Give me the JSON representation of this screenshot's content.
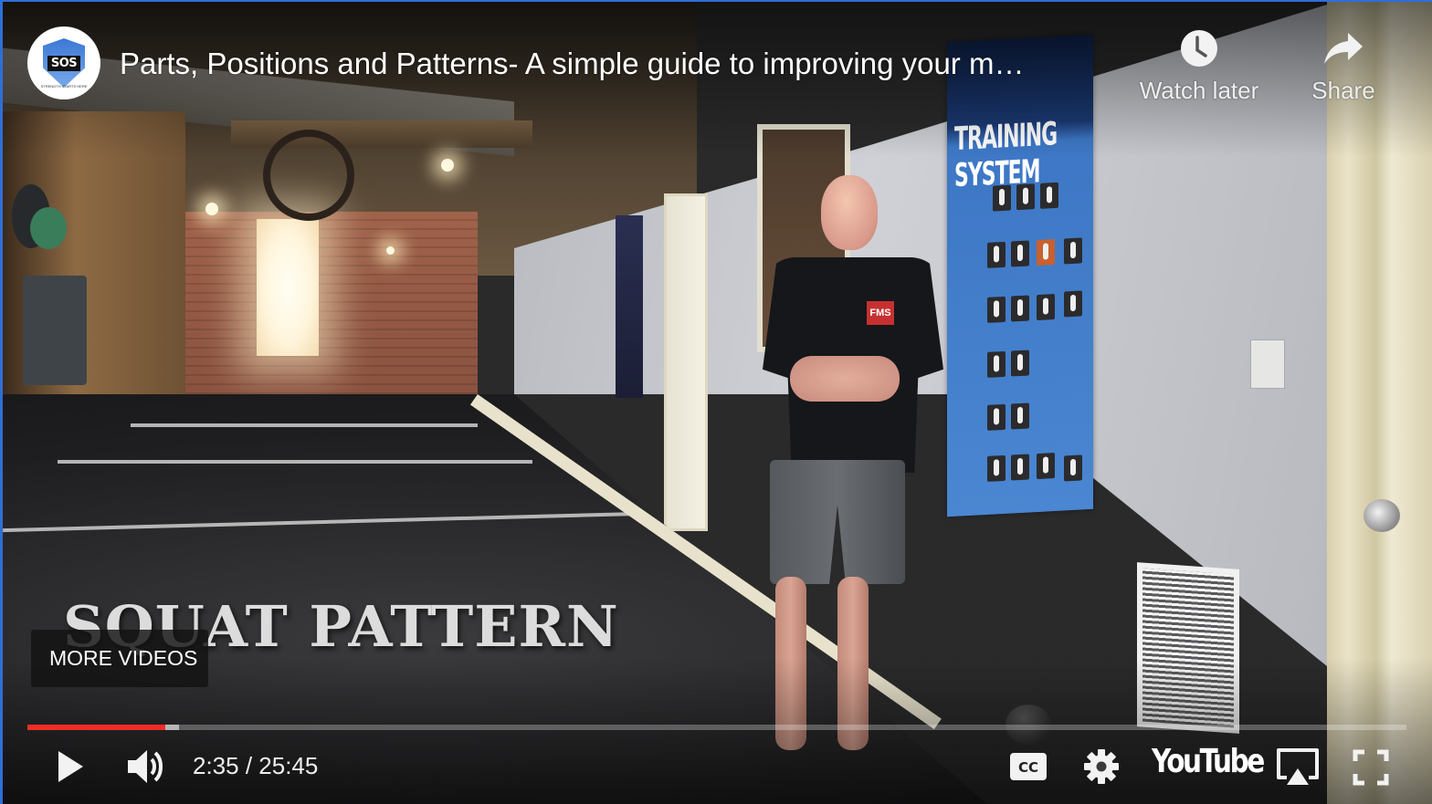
{
  "player": {
    "channel": {
      "avatar_text": "SOS",
      "avatar_caption": "STRENGTH STARTS HERE"
    },
    "title": "Parts, Positions and Patterns- A simple guide to improving your m…",
    "top_actions": [
      {
        "id": "watch-later",
        "label": "Watch later",
        "icon": "clock-icon"
      },
      {
        "id": "share",
        "label": "Share",
        "icon": "share-arrow-icon"
      }
    ],
    "video_overlay_text": "SQUAT PATTERN",
    "scene_text": {
      "poster_title": "TRAINING SYSTEM",
      "shirt_badge": "FMS"
    },
    "more_videos_label": "MORE VIDEOS",
    "progress": {
      "played_fraction": 0.1,
      "buffered_fraction": 0.11,
      "played_color": "#ef2d24"
    },
    "time": {
      "current": "2:35",
      "separator": " / ",
      "duration": "25:45",
      "display": "2:35 / 25:45"
    },
    "controls": {
      "left": [
        {
          "id": "play",
          "icon": "play-icon"
        },
        {
          "id": "volume",
          "icon": "volume-icon"
        }
      ],
      "right": [
        {
          "id": "captions",
          "icon": "cc-icon",
          "label": "CC"
        },
        {
          "id": "settings",
          "icon": "gear-icon"
        },
        {
          "id": "youtube",
          "icon": "youtube-logo",
          "label": "YouTube"
        },
        {
          "id": "airplay",
          "icon": "airplay-icon"
        },
        {
          "id": "fullscreen",
          "icon": "fullscreen-icon"
        }
      ]
    }
  }
}
